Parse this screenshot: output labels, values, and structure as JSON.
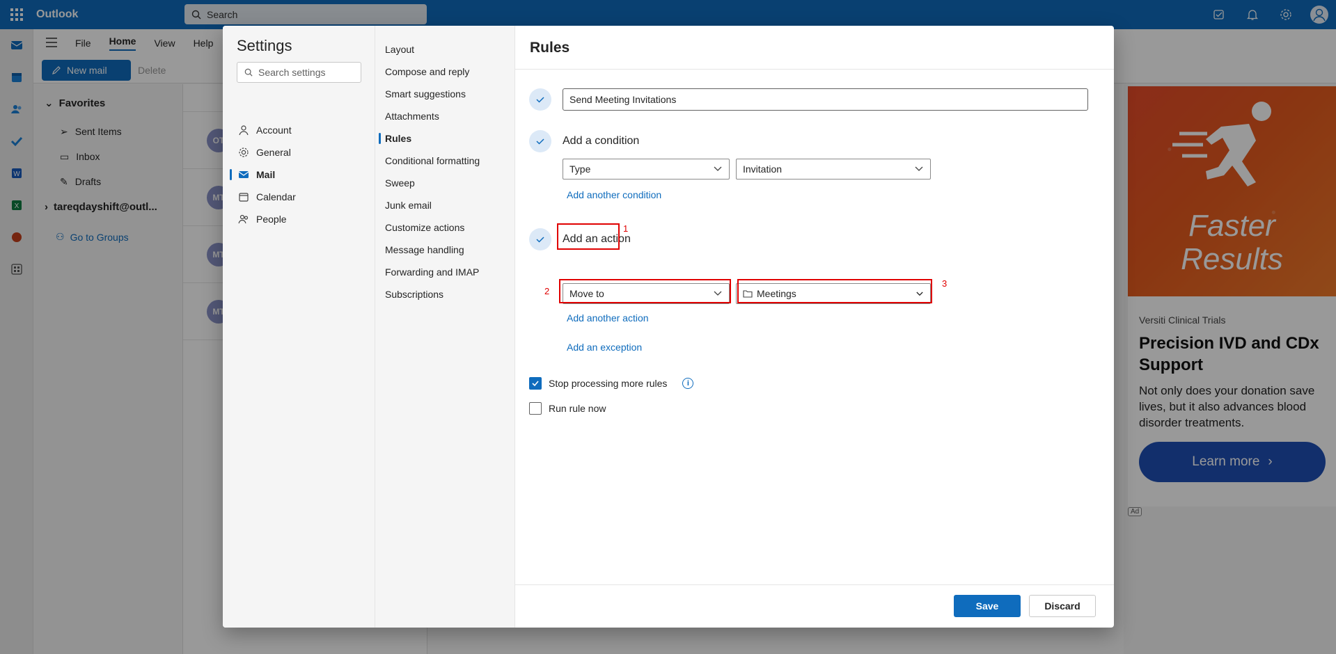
{
  "app": {
    "brand": "Outlook",
    "search_placeholder": "Search"
  },
  "ribbon": {
    "tabs": [
      "File",
      "Home",
      "View",
      "Help"
    ],
    "new_mail": "New mail",
    "delete": "Delete"
  },
  "folders": {
    "favorites": "Favorites",
    "items": [
      "Sent Items",
      "Inbox",
      "Drafts"
    ],
    "account": "tareqdayshift@outl...",
    "groups": "Go to Groups"
  },
  "messages": [
    {
      "initials": "OT"
    },
    {
      "initials": "MT"
    },
    {
      "initials": "MT"
    },
    {
      "initials": "MT"
    }
  ],
  "ad": {
    "slogan_line1": "Faster",
    "slogan_line2": "Results",
    "sponsor": "Versiti Clinical Trials",
    "headline": "Precision IVD and CDx Support",
    "body": "Not only does your donation save lives, but it also advances blood disorder treatments.",
    "cta": "Learn more",
    "badge": "Ad"
  },
  "settings": {
    "title": "Settings",
    "search_placeholder": "Search settings",
    "categories": [
      "Account",
      "General",
      "Mail",
      "Calendar",
      "People"
    ],
    "selected_category": "Mail",
    "mail_sections": [
      "Layout",
      "Compose and reply",
      "Smart suggestions",
      "Attachments",
      "Rules",
      "Conditional formatting",
      "Sweep",
      "Junk email",
      "Customize actions",
      "Message handling",
      "Forwarding and IMAP",
      "Subscriptions"
    ],
    "selected_section": "Rules"
  },
  "rules": {
    "title": "Rules",
    "rule_name": "Send Meeting Invitations",
    "condition_label": "Add a condition",
    "condition_type": "Type",
    "condition_value": "Invitation",
    "add_condition": "Add another condition",
    "action_label": "Add an action",
    "action_type": "Move to",
    "action_folder": "Meetings",
    "add_action": "Add another action",
    "add_exception": "Add an exception",
    "stop_processing": "Stop processing more rules",
    "stop_processing_checked": true,
    "run_now": "Run rule now",
    "run_now_checked": false,
    "save": "Save",
    "discard": "Discard",
    "markers": [
      "1",
      "2",
      "3"
    ]
  },
  "colors": {
    "accent": "#0f6cbd",
    "highlight": "#e00000"
  }
}
